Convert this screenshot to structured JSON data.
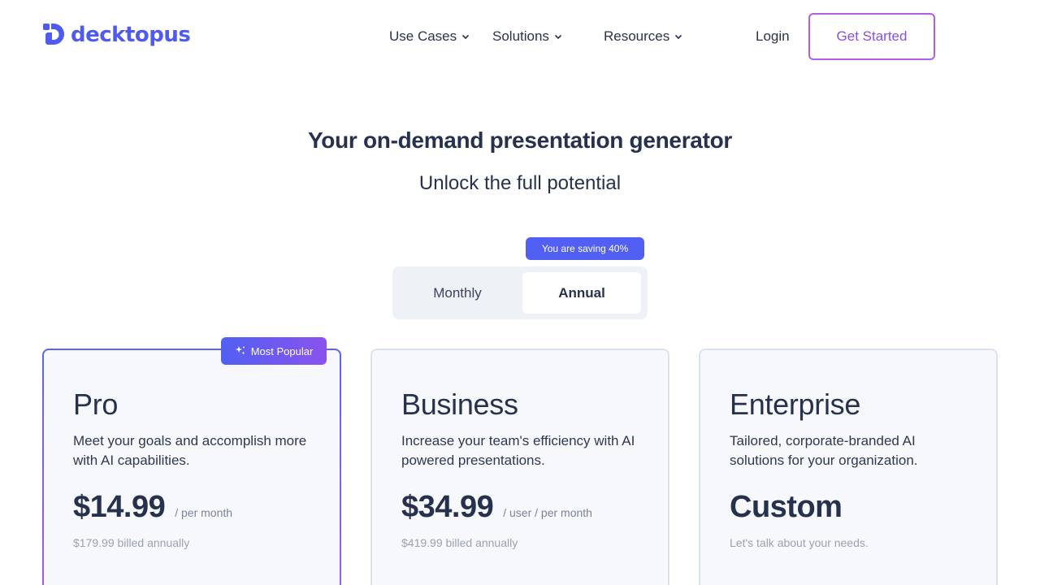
{
  "header": {
    "logo_text": "decktopus",
    "nav": [
      {
        "label": "Use Cases"
      },
      {
        "label": "Solutions"
      },
      {
        "label": "Resources"
      }
    ],
    "login_label": "Login",
    "get_started_label": "Get Started"
  },
  "hero": {
    "title": "Your on-demand presentation generator",
    "subtitle": "Unlock the full potential"
  },
  "billing_toggle": {
    "saving_badge": "You are saving 40%",
    "options": [
      {
        "label": "Monthly",
        "selected": false
      },
      {
        "label": "Annual",
        "selected": true
      }
    ]
  },
  "plans": [
    {
      "name": "Pro",
      "badge": "Most Popular",
      "description": "Meet your goals and accomplish more with AI capabilities.",
      "price": "$14.99",
      "period": "/ per month",
      "billed": "$179.99 billed annually"
    },
    {
      "name": "Business",
      "description": "Increase your team's efficiency with AI powered presentations.",
      "price": "$34.99",
      "period": "/ user / per month",
      "billed": "$419.99 billed annually"
    },
    {
      "name": "Enterprise",
      "description": "Tailored, corporate-branded AI solutions for your organization.",
      "price": "Custom",
      "period": "",
      "billed": "Let's talk about your needs."
    }
  ],
  "colors": {
    "brand": "#4f5bf0",
    "accent_purple": "#8a52ee",
    "text_dark": "#26324d"
  }
}
